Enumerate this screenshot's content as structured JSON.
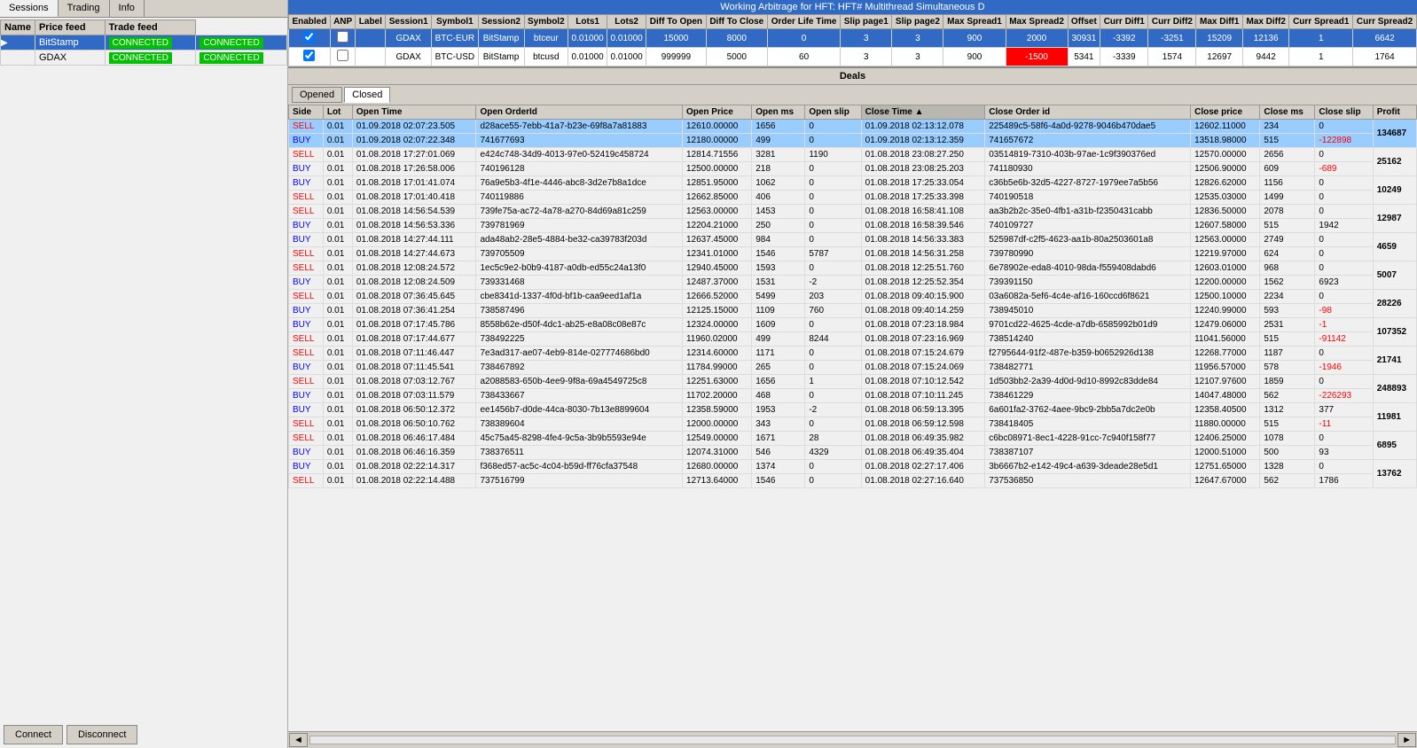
{
  "app": {
    "title": "Working Arbitrage for HFT: HFT# Multithread Simultaneous D"
  },
  "left_panel": {
    "tabs": [
      "Sessions",
      "Trading",
      "Info"
    ],
    "active_tab": "Sessions",
    "table_headers": [
      "Name",
      "Price feed",
      "Trade feed"
    ],
    "connections": [
      {
        "name": "BitStamp",
        "price_feed": "CONNECTED",
        "trade_feed": "CONNECTED",
        "selected": true
      },
      {
        "name": "GDAX",
        "price_feed": "CONNECTED",
        "trade_feed": "CONNECTED",
        "selected": false
      }
    ],
    "buttons": {
      "connect": "Connect",
      "disconnect": "Disconnect"
    }
  },
  "arb_table": {
    "headers": [
      "Enabled",
      "ANP",
      "Label",
      "Session1",
      "Symbol1",
      "Session2",
      "Symbol2",
      "Lots1",
      "Lots2",
      "Diff To Open",
      "Diff To Close",
      "Order Life Time",
      "Slip page1",
      "Slip page2",
      "Max Spread1",
      "Max Spread2",
      "Offset",
      "Curr Diff1",
      "Curr Diff2",
      "Max Diff1",
      "Max Diff2",
      "Curr Spread1",
      "Curr Spread2"
    ],
    "rows": [
      {
        "enabled": true,
        "anp": false,
        "label": "",
        "session1": "GDAX",
        "symbol1": "BTC-EUR",
        "session2": "BitStamp",
        "symbol2": "btceur",
        "lots1": "0.01000",
        "lots2": "0.01000",
        "diff_to_open": "15000",
        "diff_to_close": "8000",
        "order_life_time": "0",
        "slip_page1": "3",
        "slip_page2": "3",
        "max_spread1": "900",
        "max_spread2": "2000",
        "offset": "30931",
        "curr_diff1": "-3392",
        "curr_diff2": "-3251",
        "max_diff1": "15209",
        "max_diff2": "12136",
        "curr_spread1": "1",
        "curr_spread2": "6642",
        "row_style": "blue",
        "max_spread2_red": false
      },
      {
        "enabled": true,
        "anp": false,
        "label": "",
        "session1": "GDAX",
        "symbol1": "BTC-USD",
        "session2": "BitStamp",
        "symbol2": "btcusd",
        "lots1": "0.01000",
        "lots2": "0.01000",
        "diff_to_open": "999999",
        "diff_to_close": "5000",
        "order_life_time": "60",
        "slip_page1": "3",
        "slip_page2": "3",
        "max_spread1": "900",
        "max_spread2": "-1500",
        "offset": "5341",
        "curr_diff1": "-3339",
        "curr_diff2": "1574",
        "max_diff1": "12697",
        "max_diff2": "9442",
        "curr_spread1": "1",
        "curr_spread2": "1764",
        "row_style": "white",
        "max_spread2_red": true
      }
    ]
  },
  "deals": {
    "title": "Deals",
    "tabs": [
      "Opened",
      "Closed"
    ],
    "active_tab": "Closed",
    "headers": [
      "Side",
      "Lot",
      "Open Time",
      "Open OrderId",
      "Open Price",
      "Open ms",
      "Open slip",
      "Close Time",
      "Close Order id",
      "Close price",
      "Close ms",
      "Close slip",
      "Profit"
    ],
    "rows": [
      {
        "side1": "SELL",
        "side2": "BUY",
        "lot1": "0.01",
        "lot2": "0.01",
        "open_time1": "01.09.2018 02:07:23.505",
        "open_time2": "01.09.2018 02:07:22.348",
        "open_orderid1": "d28ace55-7ebb-41a7-b23e-69f8a7a81883",
        "open_orderid2": "741677693",
        "open_price1": "12610.00000",
        "open_price2": "12180.00000",
        "open_ms1": "1656",
        "open_ms2": "499",
        "open_slip1": "0",
        "open_slip2": "0",
        "close_time1": "01.09.2018 02:13:12.078",
        "close_time2": "01.09.2018 02:13:12.359",
        "close_orderid1": "225489c5-58f6-4a0d-9278-9046b470dae5",
        "close_orderid2": "741657672",
        "close_price1": "12602.11000",
        "close_price2": "13518.98000",
        "close_ms1": "234",
        "close_ms2": "515",
        "close_slip1": "0",
        "close_slip2": "-122898",
        "profit": "134687",
        "highlighted": true
      },
      {
        "side1": "SELL",
        "side2": "BUY",
        "lot1": "0.01",
        "lot2": "0.01",
        "open_time1": "01.08.2018 17:27:01.069",
        "open_time2": "01.08.2018 17:26:58.006",
        "open_orderid1": "e424c748-34d9-4013-97e0-52419c458724",
        "open_orderid2": "740196128",
        "open_price1": "12814.71556",
        "open_price2": "12500.00000",
        "open_ms1": "3281",
        "open_ms2": "218",
        "open_slip1": "1190",
        "open_slip2": "0",
        "close_time1": "01.08.2018 23:08:27.250",
        "close_time2": "01.08.2018 23:08:25.203",
        "close_orderid1": "03514819-7310-403b-97ae-1c9f390376ed",
        "close_orderid2": "741180930",
        "close_price1": "12570.00000",
        "close_price2": "12506.90000",
        "close_ms1": "2656",
        "close_ms2": "609",
        "close_slip1": "0",
        "close_slip2": "-689",
        "profit": "25162",
        "highlighted": false
      },
      {
        "side1": "BUY",
        "side2": "SELL",
        "lot1": "0.01",
        "lot2": "0.01",
        "open_time1": "01.08.2018 17:01:41.074",
        "open_time2": "01.08.2018 17:01:40.418",
        "open_orderid1": "76a9e5b3-4f1e-4446-abc8-3d2e7b8a1dce",
        "open_orderid2": "740119886",
        "open_price1": "12851.95000",
        "open_price2": "12662.85000",
        "open_ms1": "1062",
        "open_ms2": "406",
        "open_slip1": "0",
        "open_slip2": "0",
        "close_time1": "01.08.2018 17:25:33.054",
        "close_time2": "01.08.2018 17:25:33.398",
        "close_orderid1": "c36b5e6b-32d5-4227-8727-1979ee7a5b56",
        "close_orderid2": "740190518",
        "close_price1": "12826.62000",
        "close_price2": "12535.03000",
        "close_ms1": "1156",
        "close_ms2": "1499",
        "close_slip1": "0",
        "close_slip2": "0",
        "profit": "10249",
        "highlighted": false
      },
      {
        "side1": "SELL",
        "side2": "BUY",
        "lot1": "0.01",
        "lot2": "0.01",
        "open_time1": "01.08.2018 14:56:54.539",
        "open_time2": "01.08.2018 14:56:53.336",
        "open_orderid1": "739fe75a-ac72-4a78-a270-84d69a81c259",
        "open_orderid2": "739781969",
        "open_price1": "12563.00000",
        "open_price2": "12204.21000",
        "open_ms1": "1453",
        "open_ms2": "250",
        "open_slip1": "0",
        "open_slip2": "0",
        "close_time1": "01.08.2018 16:58:41.108",
        "close_time2": "01.08.2018 16:58:39.546",
        "close_orderid1": "aa3b2b2c-35e0-4fb1-a31b-f2350431cabb",
        "close_orderid2": "740109727",
        "close_price1": "12836.50000",
        "close_price2": "12607.58000",
        "close_ms1": "2078",
        "close_ms2": "515",
        "close_slip1": "0",
        "close_slip2": "1942",
        "profit": "12987",
        "highlighted": false
      },
      {
        "side1": "BUY",
        "side2": "SELL",
        "lot1": "0.01",
        "lot2": "0.01",
        "open_time1": "01.08.2018 14:27:44.111",
        "open_time2": "01.08.2018 14:27:44.673",
        "open_orderid1": "ada48ab2-28e5-4884-be32-ca39783f203d",
        "open_orderid2": "739705509",
        "open_price1": "12637.45000",
        "open_price2": "12341.01000",
        "open_ms1": "984",
        "open_ms2": "1546",
        "open_slip1": "0",
        "open_slip2": "5787",
        "close_time1": "01.08.2018 14:56:33.383",
        "close_time2": "01.08.2018 14:56:31.258",
        "close_orderid1": "525987df-c2f5-4623-aa1b-80a2503601a8",
        "close_orderid2": "739780990",
        "close_price1": "12563.00000",
        "close_price2": "12219.97000",
        "close_ms1": "2749",
        "close_ms2": "624",
        "close_slip1": "0",
        "close_slip2": "0",
        "profit": "4659",
        "highlighted": false
      },
      {
        "side1": "SELL",
        "side2": "BUY",
        "lot1": "0.01",
        "lot2": "0.01",
        "open_time1": "01.08.2018 12:08:24.572",
        "open_time2": "01.08.2018 12:08:24.509",
        "open_orderid1": "1ec5c9e2-b0b9-4187-a0db-ed55c24a13f0",
        "open_orderid2": "739331468",
        "open_price1": "12940.45000",
        "open_price2": "12487.37000",
        "open_ms1": "1593",
        "open_ms2": "1531",
        "open_slip1": "0",
        "open_slip2": "-2",
        "close_time1": "01.08.2018 12:25:51.760",
        "close_time2": "01.08.2018 12:25:52.354",
        "close_orderid1": "6e78902e-eda8-4010-98da-f559408dabd6",
        "close_orderid2": "739391150",
        "close_price1": "12603.01000",
        "close_price2": "12200.00000",
        "close_ms1": "968",
        "close_ms2": "1562",
        "close_slip1": "0",
        "close_slip2": "6923",
        "profit": "5007",
        "highlighted": false
      },
      {
        "side1": "SELL",
        "side2": "BUY",
        "lot1": "0.01",
        "lot2": "0.01",
        "open_time1": "01.08.2018 07:36:45.645",
        "open_time2": "01.08.2018 07:36:41.254",
        "open_orderid1": "cbe8341d-1337-4f0d-bf1b-caa9eed1af1a",
        "open_orderid2": "738587496",
        "open_price1": "12666.52000",
        "open_price2": "12125.15000",
        "open_ms1": "5499",
        "open_ms2": "1109",
        "open_slip1": "203",
        "open_slip2": "760",
        "close_time1": "01.08.2018 09:40:15.900",
        "close_time2": "01.08.2018 09:40:14.259",
        "close_orderid1": "03a6082a-5ef6-4c4e-af16-160ccd6f8621",
        "close_orderid2": "738945010",
        "close_price1": "12500.10000",
        "close_price2": "12240.99000",
        "close_ms1": "2234",
        "close_ms2": "593",
        "close_slip1": "0",
        "close_slip2": "-98",
        "profit": "28226",
        "highlighted": false
      },
      {
        "side1": "BUY",
        "side2": "SELL",
        "lot1": "0.01",
        "lot2": "0.01",
        "open_time1": "01.08.2018 07:17:45.786",
        "open_time2": "01.08.2018 07:17:44.677",
        "open_orderid1": "8558b62e-d50f-4dc1-ab25-e8a08c08e87c",
        "open_orderid2": "738492225",
        "open_price1": "12324.00000",
        "open_price2": "11960.02000",
        "open_ms1": "1609",
        "open_ms2": "499",
        "open_slip1": "0",
        "open_slip2": "8244",
        "close_time1": "01.08.2018 07:23:18.984",
        "close_time2": "01.08.2018 07:23:16.969",
        "close_orderid1": "9701cd22-4625-4cde-a7db-6585992b01d9",
        "close_orderid2": "738514240",
        "close_price1": "12479.06000",
        "close_price2": "11041.56000",
        "close_ms1": "2531",
        "close_ms2": "515",
        "close_slip1": "-1",
        "close_slip2": "-91142",
        "profit": "107352",
        "highlighted": false
      },
      {
        "side1": "SELL",
        "side2": "BUY",
        "lot1": "0.01",
        "lot2": "0.01",
        "open_time1": "01.08.2018 07:11:46.447",
        "open_time2": "01.08.2018 07:11:45.541",
        "open_orderid1": "7e3ad317-ae07-4eb9-814e-027774686bd0",
        "open_orderid2": "738467892",
        "open_price1": "12314.60000",
        "open_price2": "11784.99000",
        "open_ms1": "1171",
        "open_ms2": "265",
        "open_slip1": "0",
        "open_slip2": "0",
        "close_time1": "01.08.2018 07:15:24.679",
        "close_time2": "01.08.2018 07:15:24.069",
        "close_orderid1": "f2795644-91f2-487e-b359-b0652926d138",
        "close_orderid2": "738482771",
        "close_price1": "12268.77000",
        "close_price2": "11956.57000",
        "close_ms1": "1187",
        "close_ms2": "578",
        "close_slip1": "0",
        "close_slip2": "-1946",
        "profit": "21741",
        "highlighted": false
      },
      {
        "side1": "SELL",
        "side2": "BUY",
        "lot1": "0.01",
        "lot2": "0.01",
        "open_time1": "01.08.2018 07:03:12.767",
        "open_time2": "01.08.2018 07:03:11.579",
        "open_orderid1": "a2088583-650b-4ee9-9f8a-69a4549725c8",
        "open_orderid2": "738433667",
        "open_price1": "12251.63000",
        "open_price2": "11702.20000",
        "open_ms1": "1656",
        "open_ms2": "468",
        "open_slip1": "1",
        "open_slip2": "0",
        "close_time1": "01.08.2018 07:10:12.542",
        "close_time2": "01.08.2018 07:10:11.245",
        "close_orderid1": "1d503bb2-2a39-4d0d-9d10-8992c83dde84",
        "close_orderid2": "738461229",
        "close_price1": "12107.97600",
        "close_price2": "14047.48000",
        "close_ms1": "1859",
        "close_ms2": "562",
        "close_slip1": "0",
        "close_slip2": "-226293",
        "profit": "248893",
        "highlighted": false
      },
      {
        "side1": "BUY",
        "side2": "SELL",
        "lot1": "0.01",
        "lot2": "0.01",
        "open_time1": "01.08.2018 06:50:12.372",
        "open_time2": "01.08.2018 06:50:10.762",
        "open_orderid1": "ee1456b7-d0de-44ca-8030-7b13e8899604",
        "open_orderid2": "738389604",
        "open_price1": "12358.59000",
        "open_price2": "12000.00000",
        "open_ms1": "1953",
        "open_ms2": "343",
        "open_slip1": "-2",
        "open_slip2": "0",
        "close_time1": "01.08.2018 06:59:13.395",
        "close_time2": "01.08.2018 06:59:12.598",
        "close_orderid1": "6a601fa2-3762-4aee-9bc9-2bb5a7dc2e0b",
        "close_orderid2": "738418405",
        "close_price1": "12358.40500",
        "close_price2": "11880.00000",
        "close_ms1": "1312",
        "close_ms2": "515",
        "close_slip1": "377",
        "close_slip2": "-11",
        "profit": "11981",
        "highlighted": false
      },
      {
        "side1": "SELL",
        "side2": "BUY",
        "lot1": "0.01",
        "lot2": "0.01",
        "open_time1": "01.08.2018 06:46:17.484",
        "open_time2": "01.08.2018 06:46:16.359",
        "open_orderid1": "45c75a45-8298-4fe4-9c5a-3b9b5593e94e",
        "open_orderid2": "738376511",
        "open_price1": "12549.00000",
        "open_price2": "12074.31000",
        "open_ms1": "1671",
        "open_ms2": "546",
        "open_slip1": "28",
        "open_slip2": "4329",
        "close_time1": "01.08.2018 06:49:35.982",
        "close_time2": "01.08.2018 06:49:35.404",
        "close_orderid1": "c6bc08971-8ec1-4228-91cc-7c940f158f77",
        "close_orderid2": "738387107",
        "close_price1": "12406.25000",
        "close_price2": "12000.51000",
        "close_ms1": "1078",
        "close_ms2": "500",
        "close_slip1": "0",
        "close_slip2": "93",
        "profit": "6895",
        "highlighted": false
      },
      {
        "side1": "BUY",
        "side2": "SELL",
        "lot1": "0.01",
        "lot2": "0.01",
        "open_time1": "01.08.2018 02:22:14.317",
        "open_time2": "01.08.2018 02:22:14.488",
        "open_orderid1": "f368ed57-ac5c-4c04-b59d-ff76cfa37548",
        "open_orderid2": "737516799",
        "open_price1": "12680.00000",
        "open_price2": "12713.64000",
        "open_ms1": "1374",
        "open_ms2": "1546",
        "open_slip1": "0",
        "open_slip2": "0",
        "close_time1": "01.08.2018 02:27:17.406",
        "close_time2": "01.08.2018 02:27:16.640",
        "close_orderid1": "3b6667b2-e142-49c4-a639-3deade28e5d1",
        "close_orderid2": "737536850",
        "close_price1": "12751.65000",
        "close_price2": "12647.67000",
        "close_ms1": "1328",
        "close_ms2": "562",
        "close_slip1": "0",
        "close_slip2": "1786",
        "profit": "13762",
        "highlighted": false
      }
    ]
  }
}
